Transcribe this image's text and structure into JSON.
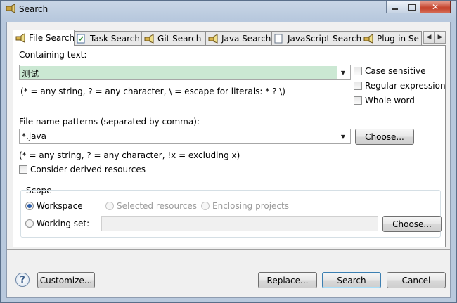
{
  "window": {
    "title": "Search"
  },
  "tabs": [
    {
      "label": "File Search"
    },
    {
      "label": "Task Search"
    },
    {
      "label": "Git Search"
    },
    {
      "label": "Java Search"
    },
    {
      "label": "JavaScript Search"
    },
    {
      "label": "Plug-in Se"
    }
  ],
  "containing": {
    "label": "Containing text:",
    "value": "测试",
    "hint": "(* = any string, ? = any character, \\ = escape for literals: * ? \\)",
    "options": {
      "case_sensitive": "Case sensitive",
      "regex": "Regular expression",
      "whole_word": "Whole word"
    }
  },
  "filename": {
    "label": "File name patterns (separated by comma):",
    "value": "*.java",
    "hint": "(* = any string, ? = any character, !x = excluding x)",
    "choose": "Choose..."
  },
  "derived": {
    "label": "Consider derived resources"
  },
  "scope": {
    "label": "Scope",
    "workspace": "Workspace",
    "selected": "Selected resources",
    "enclosing": "Enclosing projects",
    "working_set": "Working set:",
    "choose": "Choose..."
  },
  "footer": {
    "help": "?",
    "customize": "Customize...",
    "replace": "Replace...",
    "search": "Search",
    "cancel": "Cancel"
  },
  "colors": {
    "accent": "#2a5ca8",
    "highlight": "#cbe8d3"
  }
}
